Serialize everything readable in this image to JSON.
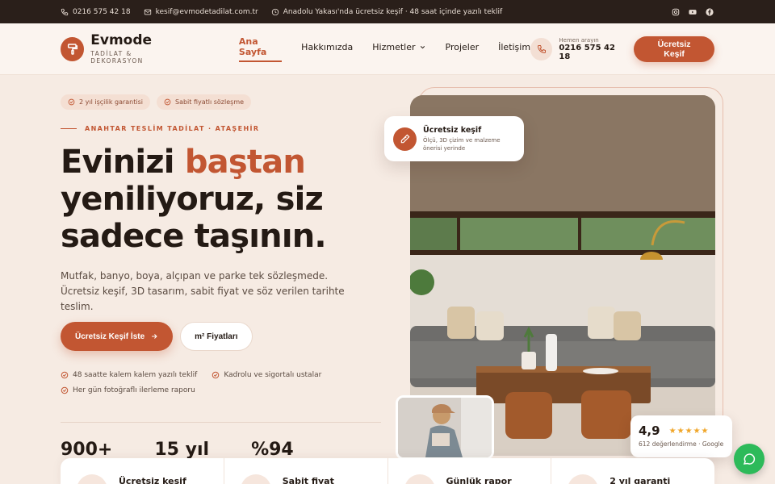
{
  "topbar": {
    "phone": "0216 575 42 18",
    "email": "kesif@evmodetadilat.com.tr",
    "notice": "Anadolu Yakası'nda ücretsiz keşif · 48 saat içinde yazılı teklif",
    "social": [
      "instagram-icon",
      "youtube-icon",
      "facebook-icon"
    ]
  },
  "header": {
    "brand": "Evmode",
    "tagline": "TADİLAT & DEKORASYON",
    "nav": [
      "Ana Sayfa",
      "Hakkımızda",
      "Hizmetler",
      "Projeler",
      "İletişim"
    ],
    "active_nav": "Ana Sayfa",
    "call_label": "Hemen arayın",
    "call_number": "0216 575 42 18",
    "cta": "Ücretsiz Keşif"
  },
  "hero": {
    "chips": [
      "2 yıl işçilik garantisi",
      "Sabit fiyatlı sözleşme"
    ],
    "eyebrow": "ANAHTAR TESLİM TADİLAT · ATAŞEHİR",
    "title_pre": "Evinizi ",
    "title_accent": "baştan",
    "title_post": " yeniliyoruz, siz sadece taşının.",
    "lead": "Mutfak, banyo, boya, alçıpan ve parke tek sözleşmede. Ücretsiz keşif, 3D tasarım, sabit fiyat ve söz verilen tarihte teslim.",
    "primary_btn": "Ücretsiz Keşif İste",
    "secondary_btn": "m² Fiyatları",
    "ticks": [
      "48 saatte kalem kalem yazılı teklif",
      "Kadrolu ve sigortalı ustalar",
      "Her gün fotoğraflı ilerleme raporu"
    ],
    "stats": [
      "900+",
      "15 yıl",
      "%94"
    ]
  },
  "float_card": {
    "title": "Ücretsiz keşif",
    "sub": "Ölçü, 3D çizim ve malzeme önerisi yerinde"
  },
  "rating": {
    "score": "4,9",
    "stars": 5,
    "sub": "612 değerlendirme · Google"
  },
  "features": [
    "Ücretsiz keşif",
    "Sabit fiyat",
    "Günlük rapor",
    "2 yıl garanti"
  ],
  "colors": {
    "accent": "#c25632",
    "topbar": "#2a1f1a",
    "whatsapp": "#2dba5a"
  }
}
